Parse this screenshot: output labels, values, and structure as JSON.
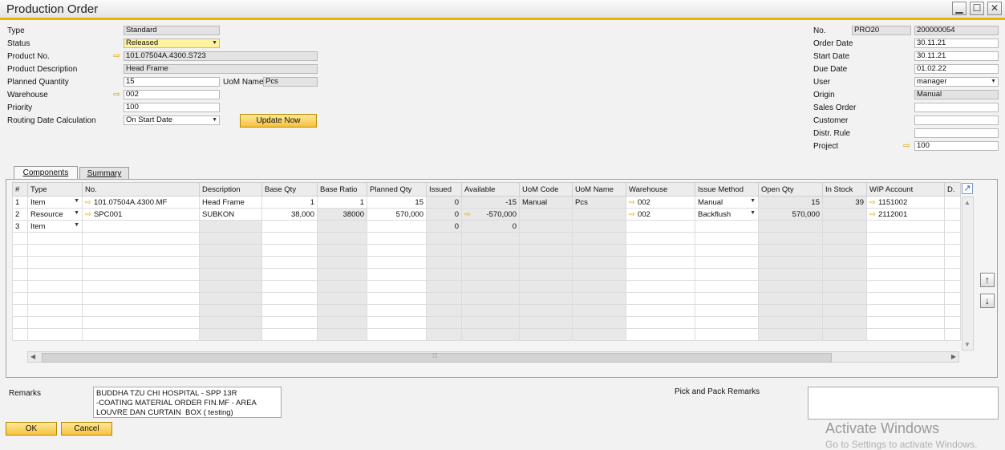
{
  "window": {
    "title": "Production Order",
    "min": "▁",
    "max": "☐",
    "close": "✕"
  },
  "header_left": {
    "type_label": "Type",
    "type_value": "Standard",
    "status_label": "Status",
    "status_value": "Released",
    "product_no_label": "Product No.",
    "product_no_value": "101.07504A.4300.S723",
    "product_desc_label": "Product Description",
    "product_desc_value": "Head Frame",
    "planned_qty_label": "Planned Quantity",
    "planned_qty_value": "15",
    "uom_label": "UoM Name",
    "uom_value": "Pcs",
    "warehouse_label": "Warehouse",
    "warehouse_value": "002",
    "priority_label": "Priority",
    "priority_value": "100",
    "routing_label": "Routing Date Calculation",
    "routing_value": "On Start Date",
    "update_button": "Update Now"
  },
  "header_right": {
    "no_label": "No.",
    "series": "PRO20",
    "number": "200000054",
    "order_date_label": "Order Date",
    "order_date": "30.11.21",
    "start_date_label": "Start Date",
    "start_date": "30.11.21",
    "due_date_label": "Due Date",
    "due_date": "01.02.22",
    "user_label": "User",
    "user": "manager",
    "origin_label": "Origin",
    "origin": "Manual",
    "sales_order_label": "Sales Order",
    "sales_order": "",
    "customer_label": "Customer",
    "customer": "",
    "distr_rule_label": "Distr. Rule",
    "distr_rule": "",
    "project_label": "Project",
    "project": "100"
  },
  "tabs": [
    {
      "label": "Components"
    },
    {
      "label": "Summary"
    }
  ],
  "grid": {
    "columns": [
      "#",
      "Type",
      "No.",
      "Description",
      "Base Qty",
      "Base Ratio",
      "Planned Qty",
      "Issued",
      "Available",
      "UoM Code",
      "UoM Name",
      "Warehouse",
      "Issue Method",
      "Open Qty",
      "In Stock",
      "WIP Account",
      "D."
    ],
    "rows": [
      [
        "1",
        "Item",
        "101.07504A.4300.MF",
        "Head Frame",
        "1",
        "1",
        "15",
        "0",
        "-15",
        "Manual",
        "Pcs",
        "002",
        "Manual",
        "15",
        "39",
        "1151002",
        ""
      ],
      [
        "2",
        "Resource",
        "SPC001",
        "SUBKON",
        "38,000",
        "38000",
        "570,000",
        "0",
        "-570,000",
        "",
        "",
        "002",
        "Backflush",
        "570,000",
        "",
        "2112001",
        ""
      ],
      [
        "3",
        "Item",
        "",
        "",
        "",
        "",
        "",
        "0",
        "0",
        "",
        "",
        "",
        "",
        "",
        "",
        "",
        ""
      ]
    ],
    "expand_icon": "↗",
    "move_up": "↑",
    "move_down": "↓",
    "grip": "⁞⁞⁞",
    "scroll_left": "◀",
    "scroll_right": "▶",
    "scroll_up": "▲",
    "scroll_down": "▼"
  },
  "footer": {
    "remarks_label": "Remarks",
    "remarks_value": "BUDDHA TZU CHI HOSPITAL - SPP 13R\n-COATING MATERIAL ORDER FIN.MF - AREA\nLOUVRE DAN CURTAIN  BOX ( testing)",
    "pick_pack_label": "Pick and Pack Remarks",
    "ok_button": "OK",
    "cancel_button": "Cancel"
  },
  "watermark": {
    "line1": "Activate Windows",
    "line2": "Go to Settings to activate Windows."
  }
}
